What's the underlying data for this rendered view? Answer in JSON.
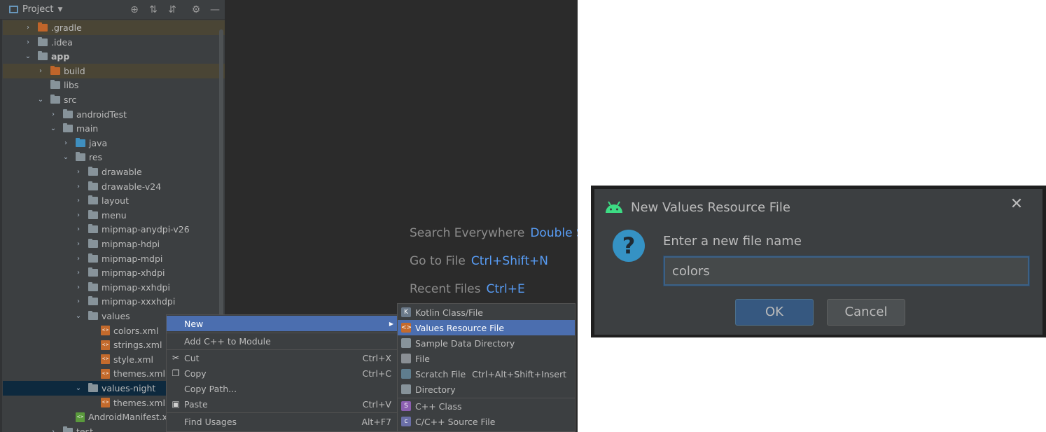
{
  "project_panel": {
    "title": "Project",
    "tree": [
      {
        "label": ".gradle",
        "arrow": "›",
        "icon": "folder-orange"
      },
      {
        "label": ".idea",
        "arrow": "›",
        "icon": "folder"
      },
      {
        "label": "app",
        "arrow": "⌄",
        "icon": "module-folder"
      },
      {
        "label": "build",
        "arrow": "›",
        "icon": "folder-orange"
      },
      {
        "label": "libs",
        "arrow": "",
        "icon": "folder"
      },
      {
        "label": "src",
        "arrow": "⌄",
        "icon": "folder"
      },
      {
        "label": "androidTest",
        "arrow": "›",
        "icon": "folder"
      },
      {
        "label": "main",
        "arrow": "⌄",
        "icon": "folder"
      },
      {
        "label": "java",
        "arrow": "›",
        "icon": "folder-blue"
      },
      {
        "label": "res",
        "arrow": "⌄",
        "icon": "res-folder"
      },
      {
        "label": "drawable",
        "arrow": "›",
        "icon": "folder"
      },
      {
        "label": "drawable-v24",
        "arrow": "›",
        "icon": "folder"
      },
      {
        "label": "layout",
        "arrow": "›",
        "icon": "folder"
      },
      {
        "label": "menu",
        "arrow": "›",
        "icon": "folder"
      },
      {
        "label": "mipmap-anydpi-v26",
        "arrow": "›",
        "icon": "folder"
      },
      {
        "label": "mipmap-hdpi",
        "arrow": "›",
        "icon": "folder"
      },
      {
        "label": "mipmap-mdpi",
        "arrow": "›",
        "icon": "folder"
      },
      {
        "label": "mipmap-xhdpi",
        "arrow": "›",
        "icon": "folder"
      },
      {
        "label": "mipmap-xxhdpi",
        "arrow": "›",
        "icon": "folder"
      },
      {
        "label": "mipmap-xxxhdpi",
        "arrow": "›",
        "icon": "folder"
      },
      {
        "label": "values",
        "arrow": "⌄",
        "icon": "folder"
      },
      {
        "label": "colors.xml",
        "arrow": "",
        "icon": "xml-file"
      },
      {
        "label": "strings.xml",
        "arrow": "",
        "icon": "xml-file"
      },
      {
        "label": "style.xml",
        "arrow": "",
        "icon": "xml-file"
      },
      {
        "label": "themes.xml",
        "arrow": "",
        "icon": "xml-file"
      },
      {
        "label": "values-night",
        "arrow": "⌄",
        "icon": "folder"
      },
      {
        "label": "themes.xml",
        "arrow": "",
        "icon": "xml-file"
      },
      {
        "label": "AndroidManifest.xml",
        "arrow": "",
        "icon": "manifest-file"
      },
      {
        "label": "test",
        "arrow": "›",
        "icon": "folder"
      }
    ]
  },
  "hints": [
    {
      "text": "Search Everywhere",
      "key": "Double Shi"
    },
    {
      "text": "Go to File",
      "key": "Ctrl+Shift+N"
    },
    {
      "text": "Recent Files",
      "key": "Ctrl+E"
    }
  ],
  "context_menu": {
    "new": "New",
    "add_cpp": "Add C++ to Module",
    "cut": "Cut",
    "cut_sc": "Ctrl+X",
    "copy": "Copy",
    "copy_sc": "Ctrl+C",
    "copy_path": "Copy Path...",
    "paste": "Paste",
    "paste_sc": "Ctrl+V",
    "find_usages": "Find Usages",
    "find_usages_sc": "Alt+F7"
  },
  "submenu": {
    "kotlin": "Kotlin Class/File",
    "values_resource": "Values Resource File",
    "sample_data": "Sample Data Directory",
    "file": "File",
    "scratch": "Scratch File",
    "scratch_sc": "Ctrl+Alt+Shift+Insert",
    "directory": "Directory",
    "cpp_class": "C++ Class",
    "cpp_source": "C/C++ Source File"
  },
  "dialog": {
    "title": "New Values Resource File",
    "prompt": "Enter a new file name",
    "input_value": "colors",
    "ok": "OK",
    "cancel": "Cancel"
  },
  "colors": {
    "selection": "#4b6eaf",
    "accent_link": "#589df6",
    "android_green": "#3ddc84"
  }
}
